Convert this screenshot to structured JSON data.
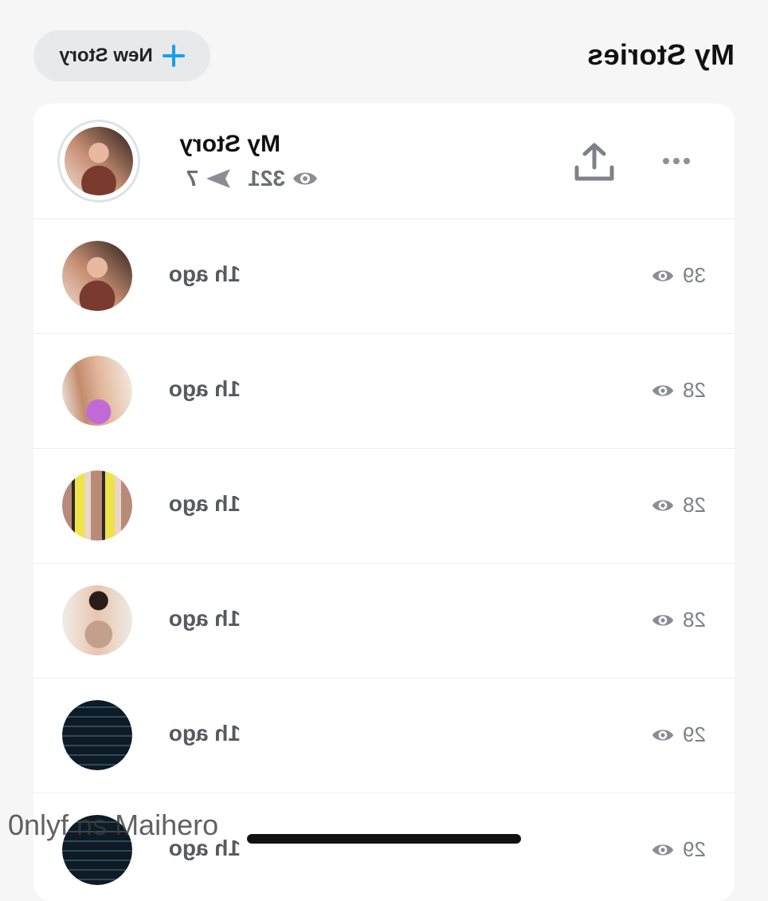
{
  "header": {
    "title": "My Stories",
    "new_story_label": "New Story"
  },
  "my_story": {
    "name": "My Story",
    "views": "321",
    "shares": "7"
  },
  "stories": [
    {
      "time": "1h ago",
      "views": "39"
    },
    {
      "time": "1h ago",
      "views": "28"
    },
    {
      "time": "1h ago",
      "views": "28"
    },
    {
      "time": "1h ago",
      "views": "28"
    },
    {
      "time": "1h ago",
      "views": "29"
    },
    {
      "time": "1h ago",
      "views": "29"
    }
  ],
  "watermark": "0nlyf ns Maihero",
  "colors": {
    "accent": "#1a9df0",
    "background": "#f6f6f6",
    "card": "#ffffff"
  },
  "icons": [
    "plus-icon",
    "share-icon",
    "more-icon",
    "eye-icon",
    "send-icon"
  ]
}
